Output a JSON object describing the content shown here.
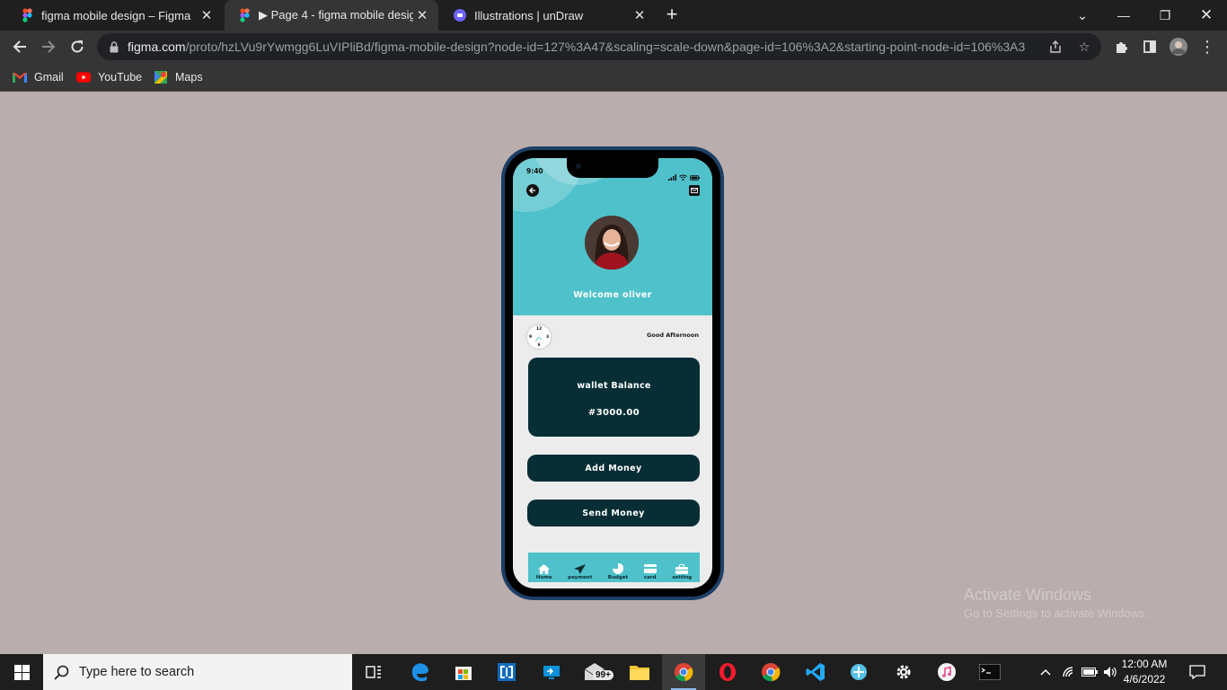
{
  "browser": {
    "tabs": [
      {
        "title": "figma mobile design – Figma",
        "active": false
      },
      {
        "title": "▶ Page 4 - figma mobile design",
        "active": true
      },
      {
        "title": "Illustrations | unDraw",
        "active": false
      }
    ],
    "url_host": "figma.com",
    "url_path": "/proto/hzLVu9rYwmgg6LuVIPliBd/figma-mobile-design?node-id=127%3A47&scaling=scale-down&page-id=106%3A2&starting-point-node-id=106%3A3",
    "bookmarks": [
      {
        "label": "Gmail",
        "icon": "gmail-icon"
      },
      {
        "label": "YouTube",
        "icon": "youtube-icon"
      },
      {
        "label": "Maps",
        "icon": "maps-icon"
      }
    ]
  },
  "app": {
    "status_time": "9:40",
    "welcome": "Welcome oliver",
    "greeting": "Good Afternoon",
    "clock_numbers": {
      "twelve": "12",
      "three": "3",
      "six": "6",
      "nine": "9"
    },
    "wallet": {
      "label": "wallet Balance",
      "value": "#3000.00"
    },
    "buttons": {
      "add_money": "Add Money",
      "send_money": "Send Money"
    },
    "nav": [
      {
        "label": "Home",
        "icon": "home-icon"
      },
      {
        "label": "payment",
        "icon": "send-icon"
      },
      {
        "label": "Budget",
        "icon": "pie-chart-icon"
      },
      {
        "label": "card",
        "icon": "card-icon"
      },
      {
        "label": "setting",
        "icon": "briefcase-icon"
      }
    ],
    "colors": {
      "accent": "#4fc1cb",
      "dark": "#072e35",
      "background": "#ececec",
      "page_bg": "#b9adad"
    }
  },
  "watermark": {
    "line1": "Activate Windows",
    "line2": "Go to Settings to activate Windows."
  },
  "taskbar": {
    "search_placeholder": "Type here to search",
    "store_badge": "99+",
    "time": "12:00 AM",
    "date": "4/6/2022"
  }
}
